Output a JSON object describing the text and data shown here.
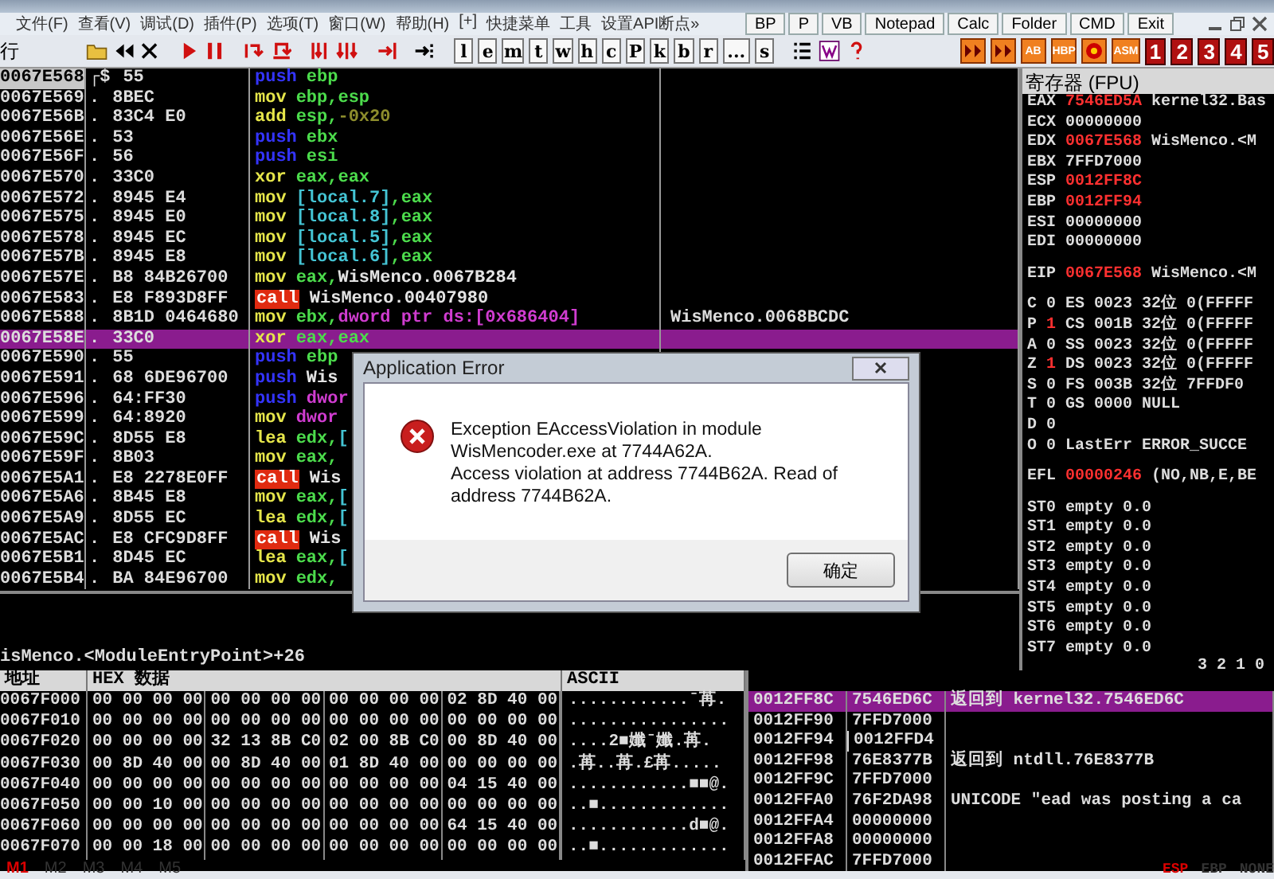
{
  "menu": [
    "文件(F)",
    "查看(V)",
    "调试(D)",
    "插件(P)",
    "选项(T)",
    "窗口(W)",
    "帮助(H)",
    "[+]",
    "快捷菜单",
    "工具",
    "设置API断点»"
  ],
  "quick_buttons": [
    "BP",
    "P",
    "VB",
    "Notepad",
    "Calc",
    "Folder",
    "CMD",
    "Exit"
  ],
  "toolbar": {
    "status": "行",
    "letter_buttons": [
      "l",
      "e",
      "m",
      "t",
      "w",
      "h",
      "c",
      "P",
      "k",
      "b",
      "r",
      "...",
      "s"
    ],
    "plugin_buttons": [
      {
        "kind": "arrows"
      },
      {
        "kind": "arrows"
      },
      {
        "kind": "label",
        "text": "AB"
      },
      {
        "kind": "label",
        "text": "HBP"
      },
      {
        "kind": "target"
      },
      {
        "kind": "label",
        "text": "ASM"
      }
    ],
    "number_buttons": [
      "1",
      "2",
      "3",
      "4",
      "5"
    ]
  },
  "disassembly": {
    "rows": [
      {
        "address": "0067E568",
        "marker": "┌$",
        "hex": "55",
        "mnemonic": "push",
        "kind": "stack",
        "operands": [
          {
            "text": "ebp",
            "kind": "reg"
          }
        ],
        "current": true,
        "selected": false
      },
      {
        "address": "0067E569",
        "marker": ".",
        "hex": "8BEC",
        "mnemonic": "mov",
        "kind": "data",
        "operands": [
          {
            "text": "ebp,esp",
            "kind": "reg"
          }
        ],
        "current": false,
        "selected": false
      },
      {
        "address": "0067E56B",
        "marker": ".",
        "hex": "83C4 E0",
        "mnemonic": "add",
        "kind": "data",
        "operands": [
          {
            "text": "esp,",
            "kind": "reg"
          },
          {
            "text": "-0x20",
            "kind": "num"
          }
        ],
        "current": false,
        "selected": false
      },
      {
        "address": "0067E56E",
        "marker": ".",
        "hex": "53",
        "mnemonic": "push",
        "kind": "stack",
        "operands": [
          {
            "text": "ebx",
            "kind": "reg"
          }
        ],
        "current": false,
        "selected": false
      },
      {
        "address": "0067E56F",
        "marker": ".",
        "hex": "56",
        "mnemonic": "push",
        "kind": "stack",
        "operands": [
          {
            "text": "esi",
            "kind": "reg"
          }
        ],
        "current": false,
        "selected": false
      },
      {
        "address": "0067E570",
        "marker": ".",
        "hex": "33C0",
        "mnemonic": "xor",
        "kind": "data",
        "operands": [
          {
            "text": "eax,eax",
            "kind": "reg"
          }
        ],
        "current": false,
        "selected": false
      },
      {
        "address": "0067E572",
        "marker": ".",
        "hex": "8945 E4",
        "mnemonic": "mov",
        "kind": "data",
        "operands": [
          {
            "text": "[local.7]",
            "kind": "mem"
          },
          {
            "text": ",eax",
            "kind": "reg"
          }
        ],
        "current": false,
        "selected": false
      },
      {
        "address": "0067E575",
        "marker": ".",
        "hex": "8945 E0",
        "mnemonic": "mov",
        "kind": "data",
        "operands": [
          {
            "text": "[local.8]",
            "kind": "mem"
          },
          {
            "text": ",eax",
            "kind": "reg"
          }
        ],
        "current": false,
        "selected": false
      },
      {
        "address": "0067E578",
        "marker": ".",
        "hex": "8945 EC",
        "mnemonic": "mov",
        "kind": "data",
        "operands": [
          {
            "text": "[local.5]",
            "kind": "mem"
          },
          {
            "text": ",eax",
            "kind": "reg"
          }
        ],
        "current": false,
        "selected": false
      },
      {
        "address": "0067E57B",
        "marker": ".",
        "hex": "8945 E8",
        "mnemonic": "mov",
        "kind": "data",
        "operands": [
          {
            "text": "[local.6]",
            "kind": "mem"
          },
          {
            "text": ",eax",
            "kind": "reg"
          }
        ],
        "current": false,
        "selected": false
      },
      {
        "address": "0067E57E",
        "marker": ".",
        "hex": "B8 84B26700",
        "mnemonic": "mov",
        "kind": "data",
        "operands": [
          {
            "text": "eax,",
            "kind": "reg"
          },
          {
            "text": "WisMenco.0067B284",
            "kind": "sym"
          }
        ],
        "current": false,
        "selected": false
      },
      {
        "address": "0067E583",
        "marker": ".",
        "hex": "E8 F893D8FF",
        "mnemonic": "call",
        "kind": "call",
        "operands": [
          {
            "text": "WisMenco.00407980",
            "kind": "sym"
          }
        ],
        "current": false,
        "selected": false
      },
      {
        "address": "0067E588",
        "marker": ".",
        "hex": "8B1D 0464680",
        "mnemonic": "mov",
        "kind": "data",
        "operands": [
          {
            "text": "ebx,",
            "kind": "reg"
          },
          {
            "text": "dword ptr ds:[0x686404]",
            "kind": "ptr"
          }
        ],
        "comment": "WisMenco.0068BCDC",
        "current": false,
        "selected": false
      },
      {
        "address": "0067E58E",
        "marker": ".",
        "hex": "33C0",
        "mnemonic": "xor",
        "kind": "data",
        "operands": [
          {
            "text": "eax,eax",
            "kind": "reg"
          }
        ],
        "current": false,
        "selected": true
      },
      {
        "address": "0067E590",
        "marker": ".",
        "hex": "55",
        "mnemonic": "push",
        "kind": "stack",
        "operands": [
          {
            "text": "ebp",
            "kind": "reg"
          }
        ],
        "current": false,
        "selected": false
      },
      {
        "address": "0067E591",
        "marker": ".",
        "hex": "68 6DE96700",
        "mnemonic": "push",
        "kind": "stack",
        "operands": [
          {
            "text": "Wis",
            "kind": "sym"
          }
        ],
        "current": false,
        "selected": false
      },
      {
        "address": "0067E596",
        "marker": ".",
        "hex": "64:FF30",
        "mnemonic": "push",
        "kind": "stack",
        "operands": [
          {
            "text": "dwor",
            "kind": "ptr"
          }
        ],
        "current": false,
        "selected": false
      },
      {
        "address": "0067E599",
        "marker": ".",
        "hex": "64:8920",
        "mnemonic": "mov",
        "kind": "data",
        "operands": [
          {
            "text": "dwor",
            "kind": "ptr"
          }
        ],
        "current": false,
        "selected": false
      },
      {
        "address": "0067E59C",
        "marker": ".",
        "hex": "8D55 E8",
        "mnemonic": "lea",
        "kind": "data",
        "operands": [
          {
            "text": "edx,",
            "kind": "reg"
          },
          {
            "text": "[",
            "kind": "mem"
          }
        ],
        "current": false,
        "selected": false
      },
      {
        "address": "0067E59F",
        "marker": ".",
        "hex": "8B03",
        "mnemonic": "mov",
        "kind": "data",
        "operands": [
          {
            "text": "eax,",
            "kind": "reg"
          }
        ],
        "current": false,
        "selected": false
      },
      {
        "address": "0067E5A1",
        "marker": ".",
        "hex": "E8 2278E0FF",
        "mnemonic": "call",
        "kind": "call",
        "operands": [
          {
            "text": "Wis",
            "kind": "sym"
          }
        ],
        "current": false,
        "selected": false
      },
      {
        "address": "0067E5A6",
        "marker": ".",
        "hex": "8B45 E8",
        "mnemonic": "mov",
        "kind": "data",
        "operands": [
          {
            "text": "eax,",
            "kind": "reg"
          },
          {
            "text": "[",
            "kind": "mem"
          }
        ],
        "current": false,
        "selected": false
      },
      {
        "address": "0067E5A9",
        "marker": ".",
        "hex": "8D55 EC",
        "mnemonic": "lea",
        "kind": "data",
        "operands": [
          {
            "text": "edx,",
            "kind": "reg"
          },
          {
            "text": "[",
            "kind": "mem"
          }
        ],
        "current": false,
        "selected": false
      },
      {
        "address": "0067E5AC",
        "marker": ".",
        "hex": "E8 CFC9D8FF",
        "mnemonic": "call",
        "kind": "call",
        "operands": [
          {
            "text": "Wis",
            "kind": "sym"
          }
        ],
        "current": false,
        "selected": false
      },
      {
        "address": "0067E5B1",
        "marker": ".",
        "hex": "8D45 EC",
        "mnemonic": "lea",
        "kind": "data",
        "operands": [
          {
            "text": "eax,",
            "kind": "reg"
          },
          {
            "text": "[",
            "kind": "mem"
          }
        ],
        "current": false,
        "selected": false
      },
      {
        "address": "0067E5B4",
        "marker": ".",
        "hex": "BA 84E96700",
        "mnemonic": "mov",
        "kind": "data",
        "operands": [
          {
            "text": "edx,",
            "kind": "reg"
          }
        ],
        "current": false,
        "selected": false
      }
    ]
  },
  "info_line": "isMenco.<ModuleEntryPoint>+26",
  "registers": {
    "title": "寄存器 (FPU)",
    "general": [
      {
        "name": "EAX",
        "value": "7546ED5A",
        "changed": true,
        "comment": "kernel32.Bas"
      },
      {
        "name": "ECX",
        "value": "00000000",
        "changed": false
      },
      {
        "name": "EDX",
        "value": "0067E568",
        "changed": true,
        "comment": "WisMenco.<M"
      },
      {
        "name": "EBX",
        "value": "7FFD7000",
        "changed": false
      },
      {
        "name": "ESP",
        "value": "0012FF8C",
        "changed": true
      },
      {
        "name": "EBP",
        "value": "0012FF94",
        "changed": true
      },
      {
        "name": "ESI",
        "value": "00000000",
        "changed": false
      },
      {
        "name": "EDI",
        "value": "00000000",
        "changed": false
      }
    ],
    "eip": {
      "name": "EIP",
      "value": "0067E568",
      "changed": true,
      "comment": "WisMenco.<M"
    },
    "flags": [
      {
        "flag": "C",
        "value": "0",
        "changed": false,
        "segment": "ES 0023 32位 0(FFFFF"
      },
      {
        "flag": "P",
        "value": "1",
        "changed": true,
        "segment": "CS 001B 32位 0(FFFFF"
      },
      {
        "flag": "A",
        "value": "0",
        "changed": false,
        "segment": "SS 0023 32位 0(FFFFF"
      },
      {
        "flag": "Z",
        "value": "1",
        "changed": true,
        "segment": "DS 0023 32位 0(FFFFF"
      },
      {
        "flag": "S",
        "value": "0",
        "changed": false,
        "segment": "FS 003B 32位 7FFDF0"
      },
      {
        "flag": "T",
        "value": "0",
        "changed": false,
        "segment": "GS 0000 NULL"
      },
      {
        "flag": "D",
        "value": "0",
        "changed": false
      },
      {
        "flag": "O",
        "value": "0",
        "changed": false,
        "segment": "LastErr ERROR_SUCCE"
      }
    ],
    "efl": {
      "name": "EFL",
      "value": "00000246",
      "changed": true,
      "comment": "(NO,NB,E,BE"
    },
    "fpu": [
      {
        "name": "ST0",
        "value": "empty 0.0"
      },
      {
        "name": "ST1",
        "value": "empty 0.0"
      },
      {
        "name": "ST2",
        "value": "empty 0.0"
      },
      {
        "name": "ST3",
        "value": "empty 0.0"
      },
      {
        "name": "ST4",
        "value": "empty 0.0"
      },
      {
        "name": "ST5",
        "value": "empty 0.0"
      },
      {
        "name": "ST6",
        "value": "empty 0.0"
      },
      {
        "name": "ST7",
        "value": "empty 0.0"
      }
    ],
    "fpu_footer": "3 2 1 0"
  },
  "dump": {
    "columns": [
      "地址",
      "HEX 数据",
      "ASCII"
    ],
    "rows": [
      {
        "address": "0067F000",
        "bytes": [
          "00 00 00 00",
          "00 00 00 00",
          "00 00 00 00",
          "02 8D 40 00"
        ],
        "ascii": "............ˉ苒."
      },
      {
        "address": "0067F010",
        "bytes": [
          "00 00 00 00",
          "00 00 00 00",
          "00 00 00 00",
          "00 00 00 00"
        ],
        "ascii": "................"
      },
      {
        "address": "0067F020",
        "bytes": [
          "00 00 00 00",
          "32 13 8B C0",
          "02 00 8B C0",
          "00 8D 40 00"
        ],
        "ascii": "....2■孅ˉ孅.苒."
      },
      {
        "address": "0067F030",
        "bytes": [
          "00 8D 40 00",
          "00 8D 40 00",
          "01 8D 40 00",
          "00 00 00 00"
        ],
        "ascii": ".苒..苒.£苒....."
      },
      {
        "address": "0067F040",
        "bytes": [
          "00 00 00 00",
          "00 00 00 00",
          "00 00 00 00",
          "04 15 40 00"
        ],
        "ascii": "............■■@."
      },
      {
        "address": "0067F050",
        "bytes": [
          "00 00 10 00",
          "00 00 00 00",
          "00 00 00 00",
          "00 00 00 00"
        ],
        "ascii": "..■............."
      },
      {
        "address": "0067F060",
        "bytes": [
          "00 00 00 00",
          "00 00 00 00",
          "00 00 00 00",
          "64 15 40 00"
        ],
        "ascii": "............d■@."
      },
      {
        "address": "0067F070",
        "bytes": [
          "00 00 18 00",
          "00 00 00 00",
          "00 00 00 00",
          "00 00 00 00"
        ],
        "ascii": "..■............."
      }
    ]
  },
  "stack": {
    "rows": [
      {
        "address": "0012FF8C",
        "value": "7546ED6C",
        "comment": "返回到 kernel32.7546ED6C",
        "frame_start": false,
        "selected": true
      },
      {
        "address": "0012FF90",
        "value": "7FFD7000",
        "frame_start": false,
        "selected": false
      },
      {
        "address": "0012FF94",
        "value": "0012FFD4",
        "frame_start": true,
        "selected": false
      },
      {
        "address": "0012FF98",
        "value": "76E8377B",
        "comment": "返回到 ntdll.76E8377B",
        "frame_start": false,
        "selected": false
      },
      {
        "address": "0012FF9C",
        "value": "7FFD7000",
        "frame_start": false,
        "selected": false
      },
      {
        "address": "0012FFA0",
        "value": "76F2DA98",
        "comment": "UNICODE \"ead was posting a ca",
        "frame_start": false,
        "selected": false
      },
      {
        "address": "0012FFA4",
        "value": "00000000",
        "frame_start": false,
        "selected": false
      },
      {
        "address": "0012FFA8",
        "value": "00000000",
        "frame_start": false,
        "selected": false
      },
      {
        "address": "0012FFAC",
        "value": "7FFD7000",
        "frame_start": false,
        "selected": false
      }
    ]
  },
  "dump_tabs": [
    {
      "label": "M1",
      "selected": true
    },
    {
      "label": "M2",
      "selected": false
    },
    {
      "label": "M3",
      "selected": false
    },
    {
      "label": "M4",
      "selected": false
    },
    {
      "label": "M5",
      "selected": false
    }
  ],
  "stack_modes": [
    {
      "label": "ESP",
      "selected": true
    },
    {
      "label": "EBP",
      "selected": false
    },
    {
      "label": "NONE",
      "selected": false
    }
  ],
  "dialog": {
    "title": "Application Error",
    "messages": [
      "Exception EAccessViolation in module WisMencoder.exe at 7744A62A.",
      "Access violation at address 7744B62A. Read of address 7744B62A."
    ],
    "button": "确定"
  }
}
